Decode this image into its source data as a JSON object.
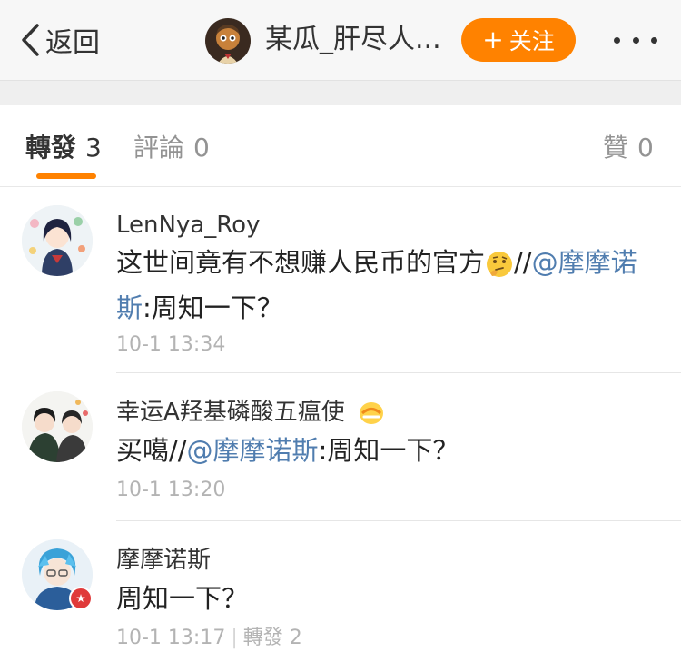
{
  "nav": {
    "back_label": "返回",
    "title": "某瓜_肝尽人...",
    "follow_label": "关注"
  },
  "tabs": [
    {
      "label": "轉發",
      "count": "3"
    },
    {
      "label": "評論",
      "count": "0"
    },
    {
      "label": "贊",
      "count": "0"
    }
  ],
  "posts": [
    {
      "username": "LenNya_Roy",
      "text_before": "这世间竟有不想赚人民币的官方",
      "text_mid": "//",
      "mention": "@摩摩诺斯",
      "text_after": ":周知一下？",
      "time": "10-1 13:34",
      "emoji": "thinking-face-emoji"
    },
    {
      "username": "幸运A羟基磷酸五瘟使",
      "username_badge": "level-badge-icon",
      "text_before": "买噶//",
      "mention": "@摩摩诺斯",
      "text_after": ":周知一下？",
      "time": "10-1 13:20"
    },
    {
      "username": "摩摩诺斯",
      "text": "周知一下？",
      "time": "10-1 13:17",
      "repost_label": "轉發 2"
    }
  ],
  "colors": {
    "accent": "#ff8200",
    "link": "#507daf",
    "meta": "#b3b3b3"
  }
}
